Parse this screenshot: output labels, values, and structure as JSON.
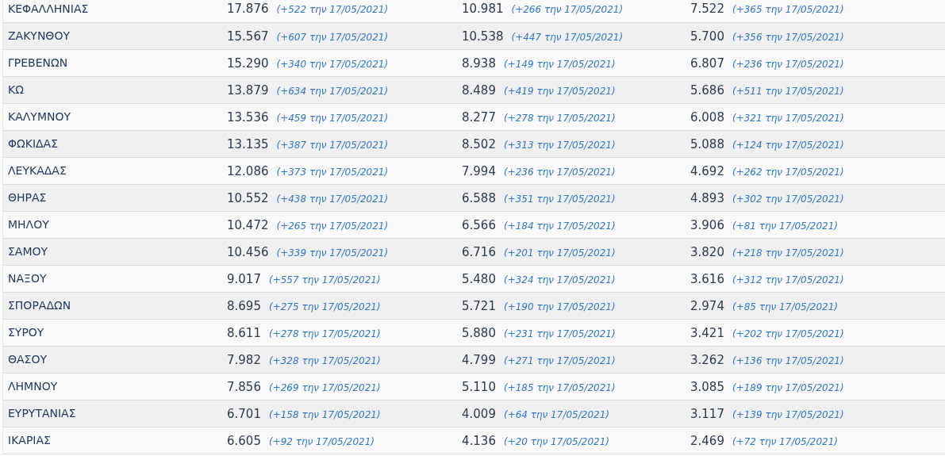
{
  "table": {
    "rows": [
      {
        "name": "ΚΕΦΑΛΛΗΝΙΑΣ",
        "cells": [
          {
            "value": "17.876",
            "change": "(+522 την 17/05/2021)"
          },
          {
            "value": "10.981",
            "change": "(+266 την 17/05/2021)"
          },
          {
            "value": "7.522",
            "change": "(+365 την 17/05/2021)"
          }
        ]
      },
      {
        "name": "ΖΑΚΥΝΘΟΥ",
        "cells": [
          {
            "value": "15.567",
            "change": "(+607 την 17/05/2021)"
          },
          {
            "value": "10.538",
            "change": "(+447 την 17/05/2021)"
          },
          {
            "value": "5.700",
            "change": "(+356 την 17/05/2021)"
          }
        ]
      },
      {
        "name": "ΓΡΕΒΕΝΩΝ",
        "cells": [
          {
            "value": "15.290",
            "change": "(+340 την 17/05/2021)"
          },
          {
            "value": "8.938",
            "change": "(+149 την 17/05/2021)"
          },
          {
            "value": "6.807",
            "change": "(+236 την 17/05/2021)"
          }
        ]
      },
      {
        "name": "ΚΩ",
        "cells": [
          {
            "value": "13.879",
            "change": "(+634 την 17/05/2021)"
          },
          {
            "value": "8.489",
            "change": "(+419 την 17/05/2021)"
          },
          {
            "value": "5.686",
            "change": "(+511 την 17/05/2021)"
          }
        ]
      },
      {
        "name": "ΚΑΛΥΜΝΟΥ",
        "cells": [
          {
            "value": "13.536",
            "change": "(+459 την 17/05/2021)"
          },
          {
            "value": "8.277",
            "change": "(+278 την 17/05/2021)"
          },
          {
            "value": "6.008",
            "change": "(+321 την 17/05/2021)"
          }
        ]
      },
      {
        "name": "ΦΩΚΙΔΑΣ",
        "cells": [
          {
            "value": "13.135",
            "change": "(+387 την 17/05/2021)"
          },
          {
            "value": "8.502",
            "change": "(+313 την 17/05/2021)"
          },
          {
            "value": "5.088",
            "change": "(+124 την 17/05/2021)"
          }
        ]
      },
      {
        "name": "ΛΕΥΚΑΔΑΣ",
        "cells": [
          {
            "value": "12.086",
            "change": "(+373 την 17/05/2021)"
          },
          {
            "value": "7.994",
            "change": "(+236 την 17/05/2021)"
          },
          {
            "value": "4.692",
            "change": "(+262 την 17/05/2021)"
          }
        ]
      },
      {
        "name": "ΘΗΡΑΣ",
        "cells": [
          {
            "value": "10.552",
            "change": "(+438 την 17/05/2021)"
          },
          {
            "value": "6.588",
            "change": "(+351 την 17/05/2021)"
          },
          {
            "value": "4.893",
            "change": "(+302 την 17/05/2021)"
          }
        ]
      },
      {
        "name": "ΜΗΛΟΥ",
        "cells": [
          {
            "value": "10.472",
            "change": "(+265 την 17/05/2021)"
          },
          {
            "value": "6.566",
            "change": "(+184 την 17/05/2021)"
          },
          {
            "value": "3.906",
            "change": "(+81 την 17/05/2021)"
          }
        ]
      },
      {
        "name": "ΣΑΜΟΥ",
        "cells": [
          {
            "value": "10.456",
            "change": "(+339 την 17/05/2021)"
          },
          {
            "value": "6.716",
            "change": "(+201 την 17/05/2021)"
          },
          {
            "value": "3.820",
            "change": "(+218 την 17/05/2021)"
          }
        ]
      },
      {
        "name": "ΝΑΞΟΥ",
        "cells": [
          {
            "value": "9.017",
            "change": "(+557 την 17/05/2021)"
          },
          {
            "value": "5.480",
            "change": "(+324 την 17/05/2021)"
          },
          {
            "value": "3.616",
            "change": "(+312 την 17/05/2021)"
          }
        ]
      },
      {
        "name": "ΣΠΟΡΑΔΩΝ",
        "cells": [
          {
            "value": "8.695",
            "change": "(+275 την 17/05/2021)"
          },
          {
            "value": "5.721",
            "change": "(+190 την 17/05/2021)"
          },
          {
            "value": "2.974",
            "change": "(+85 την 17/05/2021)"
          }
        ]
      },
      {
        "name": "ΣΥΡΟΥ",
        "cells": [
          {
            "value": "8.611",
            "change": "(+278 την 17/05/2021)"
          },
          {
            "value": "5.880",
            "change": "(+231 την 17/05/2021)"
          },
          {
            "value": "3.421",
            "change": "(+202 την 17/05/2021)"
          }
        ]
      },
      {
        "name": "ΘΑΣΟΥ",
        "cells": [
          {
            "value": "7.982",
            "change": "(+328 την 17/05/2021)"
          },
          {
            "value": "4.799",
            "change": "(+271 την 17/05/2021)"
          },
          {
            "value": "3.262",
            "change": "(+136 την 17/05/2021)"
          }
        ]
      },
      {
        "name": "ΛΗΜΝΟΥ",
        "cells": [
          {
            "value": "7.856",
            "change": "(+269 την 17/05/2021)"
          },
          {
            "value": "5.110",
            "change": "(+185 την 17/05/2021)"
          },
          {
            "value": "3.085",
            "change": "(+189 την 17/05/2021)"
          }
        ]
      },
      {
        "name": "ΕΥΡΥΤΑΝΙΑΣ",
        "cells": [
          {
            "value": "6.701",
            "change": "(+158 την 17/05/2021)"
          },
          {
            "value": "4.009",
            "change": "(+64 την 17/05/2021)"
          },
          {
            "value": "3.117",
            "change": "(+139 την 17/05/2021)"
          }
        ]
      },
      {
        "name": "ΙΚΑΡΙΑΣ",
        "cells": [
          {
            "value": "6.605",
            "change": "(+92 την 17/05/2021)"
          },
          {
            "value": "4.136",
            "change": "(+20 την 17/05/2021)"
          },
          {
            "value": "2.469",
            "change": "(+72 την 17/05/2021)"
          }
        ]
      }
    ]
  }
}
